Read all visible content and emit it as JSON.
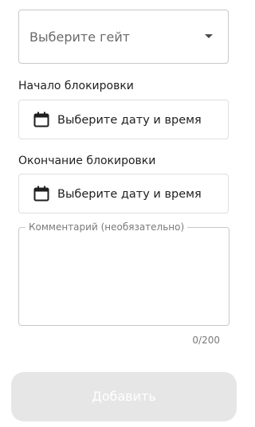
{
  "gate_select": {
    "placeholder": "Выберите гейт"
  },
  "block_start": {
    "label": "Начало блокировки",
    "placeholder": "Выберите дату и время",
    "icon": "calendar-icon"
  },
  "block_end": {
    "label": "Окончание блокировки",
    "placeholder": "Выберите дату и время",
    "icon": "calendar-icon"
  },
  "comment": {
    "label": "Комментарий (необязательно)",
    "value": "",
    "counter": "0/200"
  },
  "add_button": {
    "label": "Добавить"
  },
  "colors": {
    "border": "#c8c8c8",
    "disabled_button": "#e6e6e6",
    "muted_text": "#7a7a7a"
  }
}
